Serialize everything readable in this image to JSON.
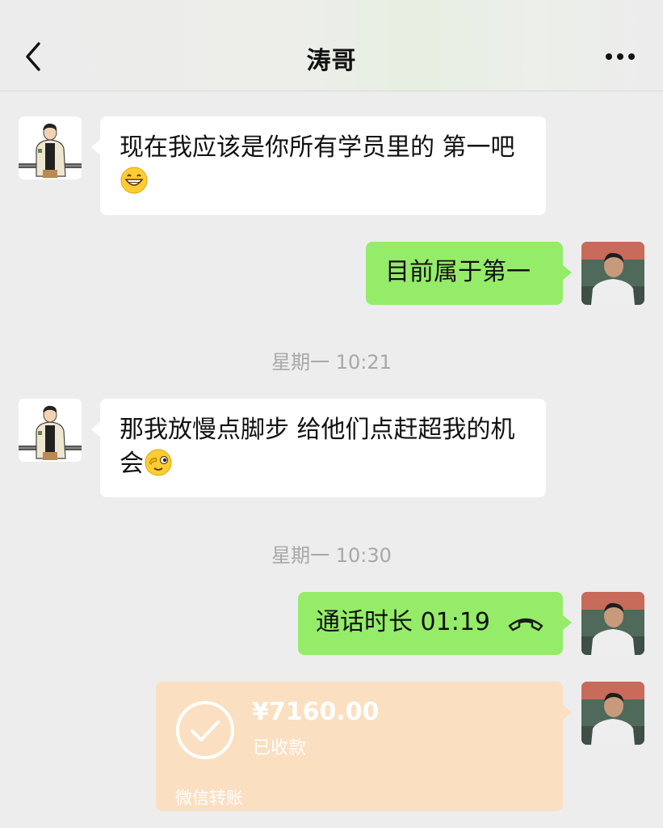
{
  "header": {
    "title": "涛哥"
  },
  "messages": {
    "m1": {
      "text": "现在我应该是你所有学员里的 第一吧",
      "emoji": "grinning-face-emoji"
    },
    "m2": {
      "text": "目前属于第一"
    },
    "t1": "星期一 10:21",
    "m3": {
      "text": "那我放慢点脚步 给他们点赶超我的机会",
      "emoji": "winking-face-emoji"
    },
    "t2": "星期一 10:30",
    "call": {
      "label": "通话时长 01:19",
      "icon": "phone-hangup-icon"
    },
    "transfer": {
      "amount": "¥7160.00",
      "status": "已收款",
      "footer": "微信转账",
      "icon": "check-circle-icon"
    }
  },
  "colors": {
    "background": "#ededed",
    "bubble_self": "#95ec69",
    "bubble_other": "#ffffff",
    "transfer": "#fbdfc1",
    "timestamp": "#a8a8a8"
  }
}
